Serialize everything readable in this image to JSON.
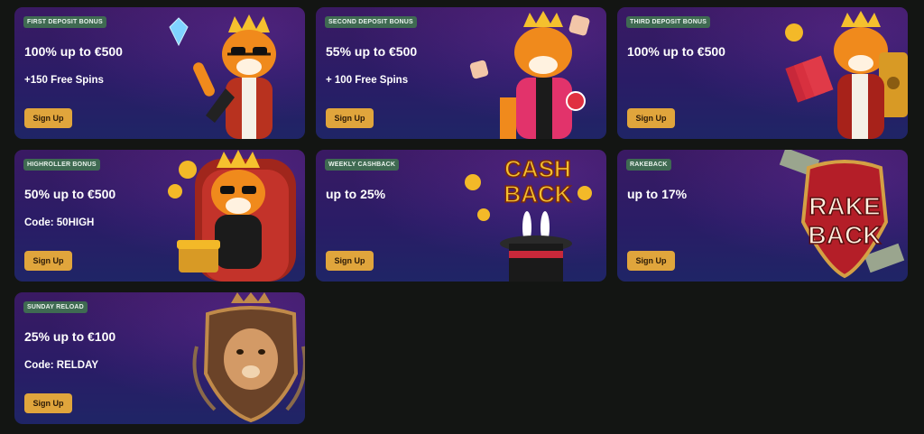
{
  "promos": [
    {
      "badge": "FIRST DEPOSIT BONUS",
      "title": "100% up to €500",
      "subtitle": "+150 Free Spins",
      "cta": "Sign Up",
      "art_icon": "tiger-diamond-icon"
    },
    {
      "badge": "SECOND DEPOSIT BONUS",
      "title": "55% up to €500",
      "subtitle": "+ 100 Free Spins",
      "cta": "Sign Up",
      "art_icon": "tiger-dice-icon"
    },
    {
      "badge": "THIRD DEPOSIT BONUS",
      "title": "100% up to €500",
      "subtitle": "",
      "cta": "Sign Up",
      "art_icon": "tiger-money-safe-icon"
    },
    {
      "badge": "HIGHROLLER BONUS",
      "title": "50% up to €500",
      "subtitle": "Code: 50HIGH",
      "cta": "Sign Up",
      "art_icon": "tiger-king-throne-icon"
    },
    {
      "badge": "WEEKLY CASHBACK",
      "title": "up to 25%",
      "subtitle": "",
      "cta": "Sign Up",
      "art_icon": "cashback-magic-hat-icon",
      "art_text_1": "CASH",
      "art_text_2": "BACK"
    },
    {
      "badge": "RAKEBACK",
      "title": "up to 17%",
      "subtitle": "",
      "cta": "Sign Up",
      "art_icon": "rakeback-shield-icon",
      "art_text_1": "RAKE",
      "art_text_2": "BACK"
    },
    {
      "badge": "SUNDAY RELOAD",
      "title": "25% up to €100",
      "subtitle": "Code: RELDAY",
      "cta": "Sign Up",
      "art_icon": "tiger-crest-icon"
    }
  ],
  "colors": {
    "page_bg": "#131513",
    "card_bg_top": "#3a1a63",
    "card_bg_bottom": "#1f2566",
    "badge_bg": "#3f6a52",
    "cta_bg": "#e0a53c",
    "text": "#ffffff"
  }
}
